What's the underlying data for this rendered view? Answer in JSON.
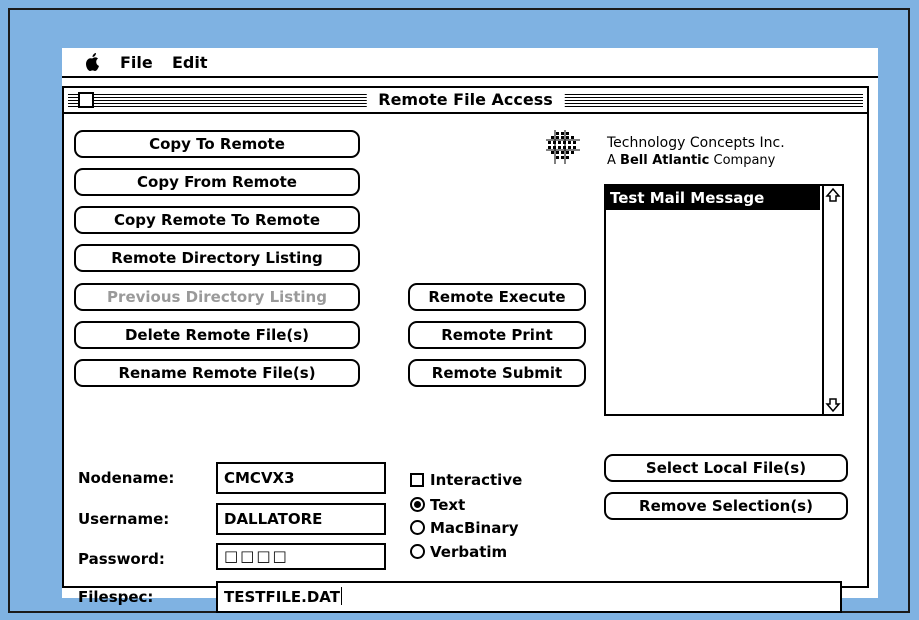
{
  "menubar": {
    "items": [
      "File",
      "Edit"
    ]
  },
  "window": {
    "title": "Remote File Access"
  },
  "buttons_left": [
    {
      "label": "Copy To Remote",
      "enabled": true
    },
    {
      "label": "Copy From Remote",
      "enabled": true
    },
    {
      "label": "Copy Remote To Remote",
      "enabled": true
    },
    {
      "label": "Remote Directory Listing",
      "enabled": true
    },
    {
      "label": "Previous Directory Listing",
      "enabled": false
    },
    {
      "label": "Delete Remote File(s)",
      "enabled": true
    },
    {
      "label": "Rename Remote File(s)",
      "enabled": true
    }
  ],
  "buttons_middle": [
    {
      "label": "Remote Execute"
    },
    {
      "label": "Remote Print"
    },
    {
      "label": "Remote Submit"
    }
  ],
  "company": {
    "name": "Technology Concepts Inc.",
    "tagline_prefix": "A",
    "tagline_bold": "Bell Atlantic",
    "tagline_suffix": "Company"
  },
  "file_list": {
    "selected": "Test Mail Message"
  },
  "buttons_right": [
    {
      "label": "Select Local File(s)"
    },
    {
      "label": "Remove Selection(s)"
    }
  ],
  "form": {
    "nodename_label": "Nodename:",
    "nodename_value": "CMCVX3",
    "username_label": "Username:",
    "username_value": "DALLATORE",
    "password_label": "Password:",
    "password_value": "□□□□",
    "filespec_label": "Filespec:",
    "filespec_value": "TESTFILE.DAT"
  },
  "options": {
    "interactive_label": "Interactive",
    "interactive_checked": false,
    "modes": [
      "Text",
      "MacBinary",
      "Verbatim"
    ],
    "selected_mode": "Text"
  },
  "colors": {
    "background": "#7fb2e2",
    "disabled_text": "#9a9a9a"
  },
  "icons": [
    "apple-icon",
    "close-box-icon",
    "company-logo",
    "scroll-up-arrow-icon",
    "scroll-down-arrow-icon"
  ]
}
